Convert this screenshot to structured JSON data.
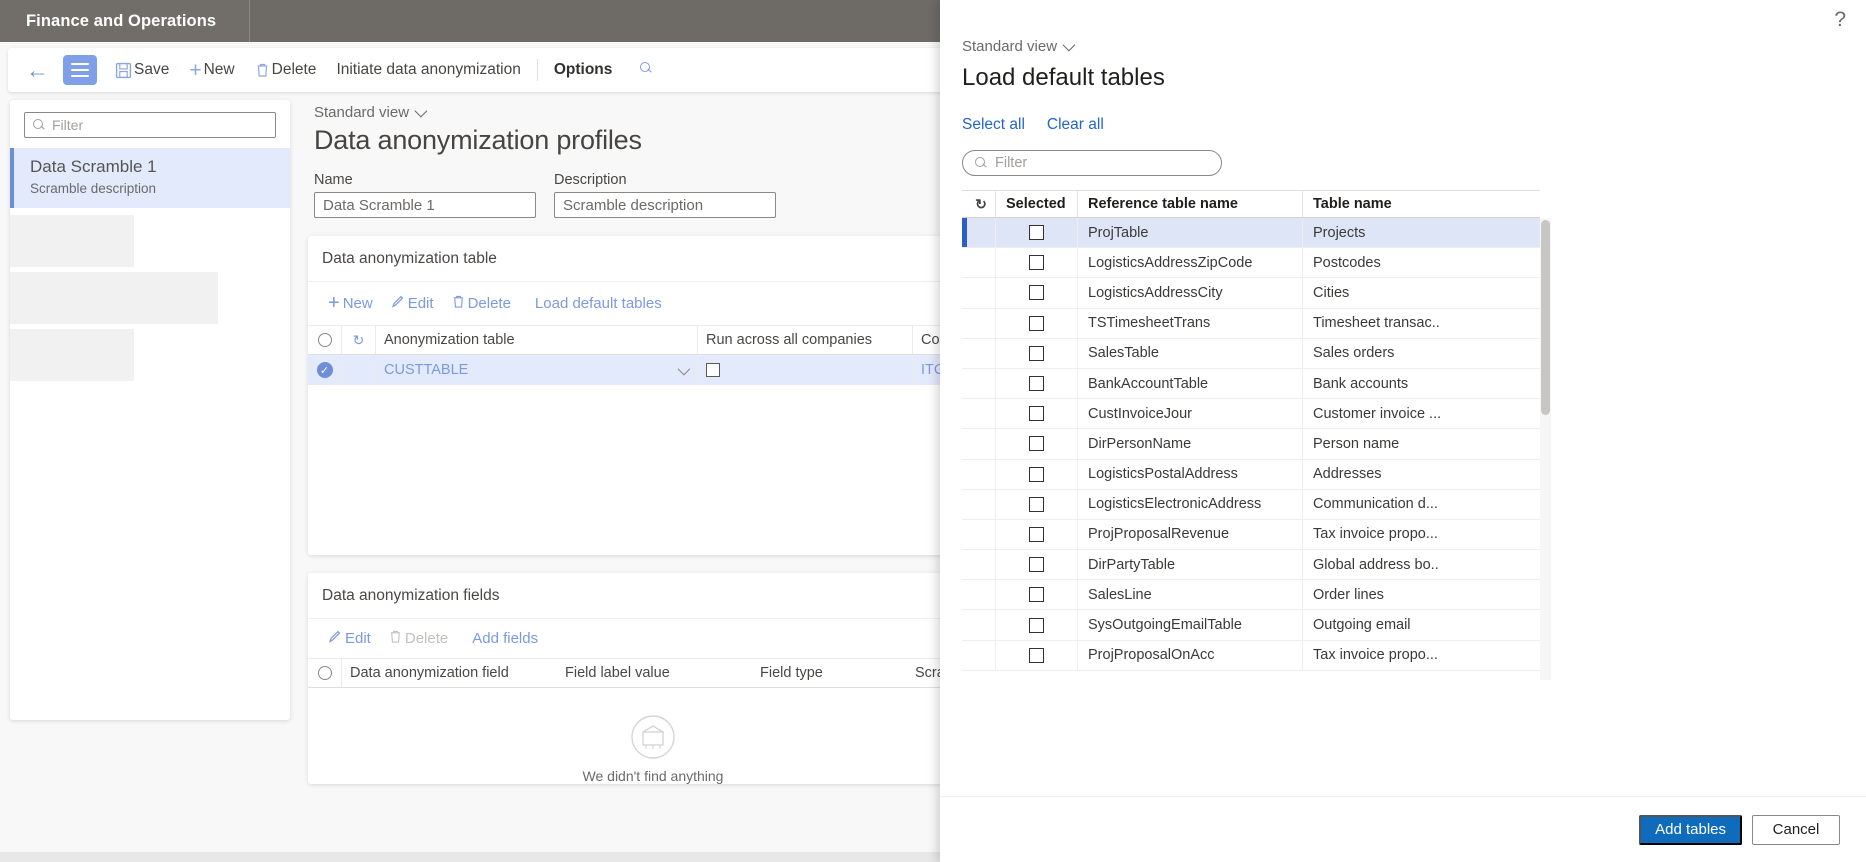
{
  "app": {
    "tab_label": "Finance and Operations",
    "brand_gray": "#6e6b67",
    "accent_blue": "#0f6cbd",
    "link_blue": "#7b9ae0",
    "selection_blue": "#e3eafc"
  },
  "action_bar": {
    "back_icon": "back-arrow-icon",
    "nav_icon": "hamburger-icon",
    "save_label": "Save",
    "new_label": "New",
    "delete_label": "Delete",
    "initiate_label": "Initiate data anonymization",
    "options_label": "Options",
    "search_icon": "search-icon"
  },
  "list_panel": {
    "filter_placeholder": "Filter",
    "selected": {
      "title": "Data Scramble 1",
      "subtitle": "Scramble description"
    }
  },
  "form": {
    "view_label": "Standard view",
    "title": "Data anonymization profiles",
    "fields": [
      {
        "label": "Name",
        "value": "Data Scramble 1"
      },
      {
        "label": "Description",
        "value": "Scramble description"
      }
    ],
    "table_card": {
      "heading": "Data anonymization table",
      "tools": [
        {
          "label": "New",
          "icon": "plus-icon",
          "enabled": true
        },
        {
          "label": "Edit",
          "icon": "pencil-icon",
          "enabled": true
        },
        {
          "label": "Delete",
          "icon": "trash-icon",
          "enabled": true
        },
        {
          "label": "Load default tables",
          "icon": "",
          "enabled": true
        }
      ],
      "columns": [
        "Anonymization table",
        "Run across all companies",
        "Com"
      ],
      "rows": [
        {
          "table": "CUSTTABLE",
          "run_across": false,
          "company": "ITCC"
        }
      ]
    },
    "fields_card": {
      "heading": "Data anonymization fields",
      "tools": [
        {
          "label": "Edit",
          "icon": "pencil-icon",
          "enabled": true
        },
        {
          "label": "Delete",
          "icon": "trash-icon",
          "enabled": false
        },
        {
          "label": "Add fields",
          "icon": "",
          "enabled": true
        }
      ],
      "columns": [
        "Data anonymization field",
        "Field label value",
        "Field type",
        "Scrambl"
      ],
      "empty_message": "We didn't find anything"
    }
  },
  "dialog": {
    "help_icon": "question-mark-icon",
    "view_label": "Standard view",
    "title": "Load default tables",
    "select_all_label": "Select all",
    "clear_all_label": "Clear all",
    "filter_placeholder": "Filter",
    "grid": {
      "refresh_icon": "refresh-icon",
      "column_options_icon": "column-options-icon",
      "columns": [
        "Selected",
        "Reference table name",
        "Table name"
      ],
      "rows": [
        {
          "selected": false,
          "reference_table_name": "ProjTable",
          "table_name": "Projects",
          "highlighted": true
        },
        {
          "selected": false,
          "reference_table_name": "LogisticsAddressZipCode",
          "table_name": "Postcodes",
          "highlighted": false
        },
        {
          "selected": false,
          "reference_table_name": "LogisticsAddressCity",
          "table_name": "Cities",
          "highlighted": false
        },
        {
          "selected": false,
          "reference_table_name": "TSTimesheetTrans",
          "table_name": "Timesheet transac...",
          "highlighted": false
        },
        {
          "selected": false,
          "reference_table_name": "SalesTable",
          "table_name": "Sales orders",
          "highlighted": false
        },
        {
          "selected": false,
          "reference_table_name": "BankAccountTable",
          "table_name": "Bank accounts",
          "highlighted": false
        },
        {
          "selected": false,
          "reference_table_name": "CustInvoiceJour",
          "table_name": "Customer invoice ...",
          "highlighted": false
        },
        {
          "selected": false,
          "reference_table_name": "DirPersonName",
          "table_name": "Person name",
          "highlighted": false
        },
        {
          "selected": false,
          "reference_table_name": "LogisticsPostalAddress",
          "table_name": "Addresses",
          "highlighted": false
        },
        {
          "selected": false,
          "reference_table_name": "LogisticsElectronicAddress",
          "table_name": "Communication d...",
          "highlighted": false
        },
        {
          "selected": false,
          "reference_table_name": "ProjProposalRevenue",
          "table_name": "Tax invoice propo...",
          "highlighted": false
        },
        {
          "selected": false,
          "reference_table_name": "DirPartyTable",
          "table_name": "Global address bo...",
          "highlighted": false
        },
        {
          "selected": false,
          "reference_table_name": "SalesLine",
          "table_name": "Order lines",
          "highlighted": false
        },
        {
          "selected": false,
          "reference_table_name": "SysOutgoingEmailTable",
          "table_name": "Outgoing email",
          "highlighted": false
        },
        {
          "selected": false,
          "reference_table_name": "ProjProposalOnAcc",
          "table_name": "Tax invoice propo...",
          "highlighted": false
        }
      ]
    },
    "footer": {
      "primary_label": "Add tables",
      "secondary_label": "Cancel"
    }
  }
}
